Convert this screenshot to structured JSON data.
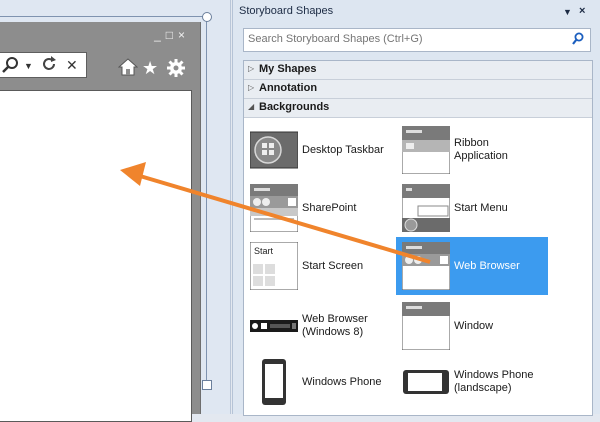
{
  "browser": {
    "window_buttons": "_□×",
    "addr_icons": [
      "search-icon",
      "dropdown-icon",
      "refresh-icon",
      "close-icon"
    ],
    "tool_icons": [
      "home-icon",
      "favorites-star-icon",
      "gear-icon"
    ]
  },
  "panel": {
    "title": "Storyboard Shapes",
    "dropdown_glyph": "▼",
    "close_glyph": "×",
    "search": {
      "placeholder": "Search Storyboard Shapes (Ctrl+G)",
      "value": ""
    },
    "categories": [
      {
        "label": "My Shapes",
        "expanded": false
      },
      {
        "label": "Annotation",
        "expanded": false
      },
      {
        "label": "Backgrounds",
        "expanded": true
      }
    ],
    "shapes": [
      {
        "label": "Desktop Taskbar",
        "icon": "desktop-taskbar-icon",
        "selected": false
      },
      {
        "label": "Ribbon\nApplication",
        "icon": "ribbon-application-icon",
        "selected": false
      },
      {
        "label": "SharePoint",
        "icon": "sharepoint-icon",
        "selected": false
      },
      {
        "label": "Start Menu",
        "icon": "start-menu-icon",
        "selected": false
      },
      {
        "label": "Start Screen",
        "icon": "start-screen-icon",
        "selected": false
      },
      {
        "label": "Web Browser",
        "icon": "web-browser-icon",
        "selected": true
      },
      {
        "label": "Web Browser\n(Windows 8)",
        "icon": "web-browser-win8-icon",
        "selected": false
      },
      {
        "label": "Window",
        "icon": "window-icon",
        "selected": false
      },
      {
        "label": "Windows Phone",
        "icon": "windows-phone-icon",
        "selected": false
      },
      {
        "label": "Windows Phone\n(landscape)",
        "icon": "windows-phone-landscape-icon",
        "selected": false
      }
    ],
    "start_screen_thumb_text": "Start"
  },
  "colors": {
    "selection": "#3c9bef",
    "arrow": "#f0842c",
    "browser_chrome": "#8d8d8d"
  }
}
